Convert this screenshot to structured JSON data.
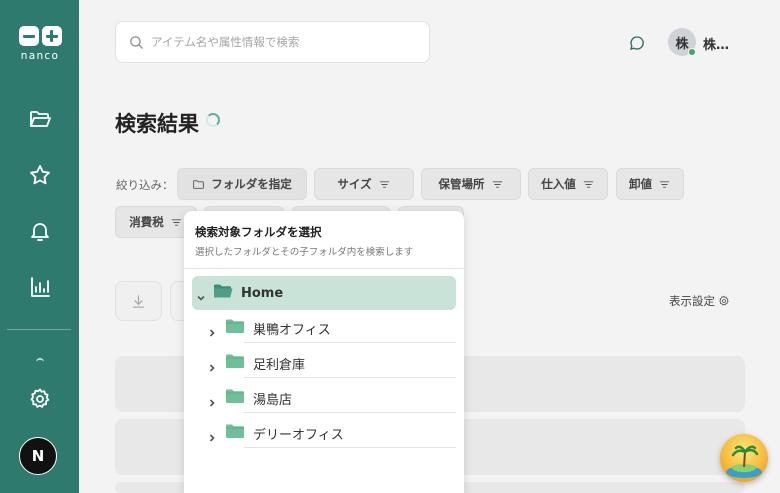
{
  "brand": {
    "name": "nanco"
  },
  "search": {
    "placeholder": "アイテム名や属性情報で検索"
  },
  "user": {
    "initial": "株",
    "name": "株…"
  },
  "page": {
    "title": "検索結果"
  },
  "filters": {
    "label": "絞り込み：",
    "chips": [
      {
        "label": "フォルダを指定",
        "icon": "folder-icon"
      },
      {
        "label": "サイズ",
        "icon": "filter-icon"
      },
      {
        "label": "保管場所",
        "icon": "filter-icon"
      },
      {
        "label": "仕入値",
        "icon": "filter-icon"
      },
      {
        "label": "卸値",
        "icon": "filter-icon"
      },
      {
        "label": "消費税",
        "icon": "filter-icon"
      }
    ]
  },
  "toolbar": {
    "display_settings": "表示設定"
  },
  "folder_picker": {
    "title": "検索対象フォルダを選択",
    "subtitle": "選択したフォルダとその子フォルダ内を検索します",
    "root": {
      "label": "Home"
    },
    "children": [
      {
        "label": "巣鴨オフィス"
      },
      {
        "label": "足利倉庫"
      },
      {
        "label": "湯島店"
      },
      {
        "label": "デリーオフィス"
      }
    ]
  },
  "sidebar": {
    "items": [
      {
        "icon": "folder-open-icon"
      },
      {
        "icon": "star-icon"
      },
      {
        "icon": "bell-icon"
      },
      {
        "icon": "bar-chart-icon"
      },
      {
        "icon": "gear-icon"
      }
    ],
    "account_initial": "N"
  },
  "colors": {
    "sidebar": "#2f7a6e",
    "accent": "#5fae9c",
    "selected": "#c9e3d9",
    "folder": "#6fbf9a"
  }
}
